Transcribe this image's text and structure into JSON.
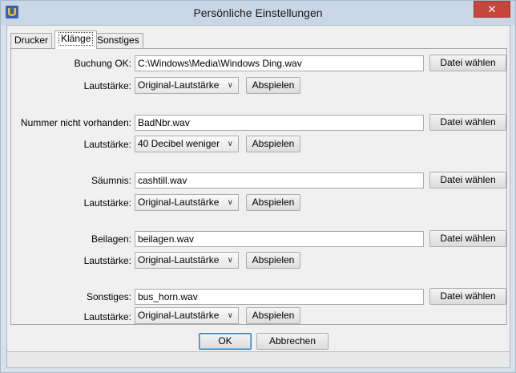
{
  "window": {
    "title": "Persönliche Einstellungen",
    "close_glyph": "✕"
  },
  "tabs": [
    {
      "label": "Drucker",
      "active": false
    },
    {
      "label": "Klänge",
      "active": true
    },
    {
      "label": "Sonstiges",
      "active": false
    }
  ],
  "sounds": [
    {
      "label": "Buchung OK:",
      "file": "C:\\Windows\\Media\\Windows Ding.wav",
      "volume_label": "Lautstärke:",
      "volume": "Original-Lautstärke"
    },
    {
      "label": "Nummer nicht vorhanden:",
      "file": "BadNbr.wav",
      "volume_label": "Lautstärke:",
      "volume": "40 Decibel weniger"
    },
    {
      "label": "Säumnis:",
      "file": "cashtill.wav",
      "volume_label": "Lautstärke:",
      "volume": "Original-Lautstärke"
    },
    {
      "label": "Beilagen:",
      "file": "beilagen.wav",
      "volume_label": "Lautstärke:",
      "volume": "Original-Lautstärke"
    },
    {
      "label": "Sonstiges:",
      "file": "bus_horn.wav",
      "volume_label": "Lautstärke:",
      "volume": "Original-Lautstärke"
    }
  ],
  "buttons": {
    "choose_file": "Datei wählen",
    "play": "Abspielen",
    "ok": "OK",
    "cancel": "Abbrechen"
  },
  "icons": {
    "app": "app-icon",
    "dropdown": "chevron-down-icon"
  }
}
